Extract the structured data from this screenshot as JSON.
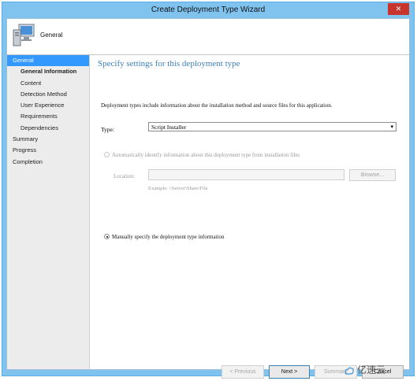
{
  "window": {
    "title": "Create Deployment Type Wizard",
    "close_glyph": "✕"
  },
  "header": {
    "title": "General",
    "icon": "computer-icon"
  },
  "nav": {
    "items": [
      {
        "label": "General",
        "level": 0,
        "selected": true
      },
      {
        "label": "General Information",
        "level": 1,
        "current": true
      },
      {
        "label": "Content",
        "level": 1
      },
      {
        "label": "Detection Method",
        "level": 1
      },
      {
        "label": "User Experience",
        "level": 1
      },
      {
        "label": "Requirements",
        "level": 1
      },
      {
        "label": "Dependencies",
        "level": 1
      },
      {
        "label": "Summary",
        "level": 0
      },
      {
        "label": "Progress",
        "level": 0
      },
      {
        "label": "Completion",
        "level": 0
      }
    ]
  },
  "content": {
    "heading": "Specify settings for this deployment type",
    "intro": "Deployment types include information about the installation method and source files for this application.",
    "type_label": "Type:",
    "type_value": "Script Installer",
    "auto_option": "Automatically identify information about this deployment type from installation files",
    "location_label": "Location:",
    "location_value": "",
    "browse_label": "Browse...",
    "example": "Example: \\\\Server\\Share\\File",
    "manual_option": "Manually specify the deployment type information"
  },
  "buttons": {
    "previous": "< Previous",
    "next": "Next >",
    "summary": "Summary",
    "cancel": "Cancel"
  },
  "watermark": {
    "text": "亿速云"
  },
  "colors": {
    "accent": "#3399ff",
    "heading": "#3e80b8",
    "frame": "#7fc3ee"
  }
}
